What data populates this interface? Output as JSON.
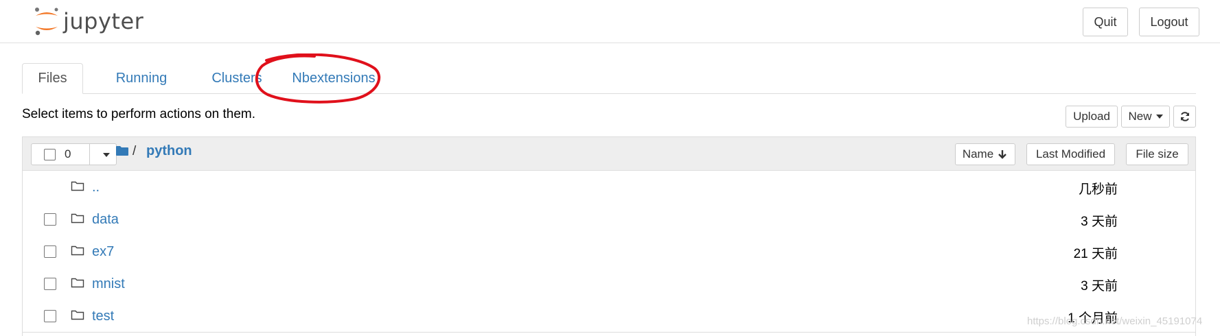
{
  "header": {
    "logo_text": "jupyter",
    "quit_label": "Quit",
    "logout_label": "Logout"
  },
  "tabs": [
    {
      "label": "Files"
    },
    {
      "label": "Running"
    },
    {
      "label": "Clusters"
    },
    {
      "label": "Nbextensions"
    }
  ],
  "toolbar": {
    "hint": "Select items to perform actions on them.",
    "upload_label": "Upload",
    "new_label": "New"
  },
  "list_header": {
    "selected_count": "0",
    "breadcrumb_sep": "/",
    "breadcrumb_folder": "python",
    "sort_name": "Name",
    "sort_modified": "Last Modified",
    "sort_size": "File size"
  },
  "rows": [
    {
      "name": "..",
      "modified": "几秒前",
      "has_checkbox": false
    },
    {
      "name": "data",
      "modified": "3 天前",
      "has_checkbox": true
    },
    {
      "name": "ex7",
      "modified": "21 天前",
      "has_checkbox": true
    },
    {
      "name": "mnist",
      "modified": "3 天前",
      "has_checkbox": true
    },
    {
      "name": "test",
      "modified": "1 个月前",
      "has_checkbox": true
    }
  ],
  "watermark": "https://blog.csdn.net/weixin_45191074",
  "colors": {
    "link": "#337ab7",
    "annotation": "#e0101b",
    "logo_orange": "#f37726"
  },
  "icons": {
    "folder": "folder-outline-icon",
    "breadcrumb": "folder-solid-icon",
    "refresh": "refresh-icon",
    "sort": "arrow-down-icon"
  }
}
